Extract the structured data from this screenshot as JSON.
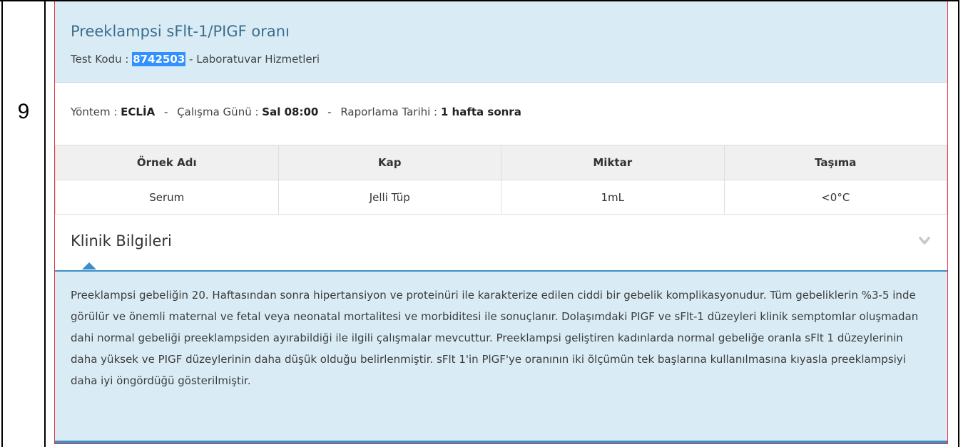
{
  "row": {
    "number": "9"
  },
  "test": {
    "title": "Preeklampsi sFlt-1/PIGF oranı",
    "code_label": "Test Kodu : ",
    "code_value": "8742503",
    "department": " - Laboratuvar Hizmetleri"
  },
  "method": {
    "method_label": "Yöntem : ",
    "method_value": "ECLİA",
    "day_label": "Çalışma Günü : ",
    "day_value": "Sal 08:00",
    "report_label": "Raporlama Tarihi : ",
    "report_value": "1 hafta sonra",
    "separator": "-"
  },
  "sample_table": {
    "headers": [
      "Örnek Adı",
      "Kap",
      "Miktar",
      "Taşıma"
    ],
    "rows": [
      [
        "Serum",
        "Jelli Tüp",
        "1mL",
        "<0°C"
      ]
    ]
  },
  "clinic": {
    "title": "Klinik Bilgileri",
    "text": "Preeklampsi gebeliğin 20. Haftasından sonra hipertansiyon ve proteinüri ile karakterize edilen ciddi bir gebelik komplikasyonudur. Tüm gebeliklerin %3-5  inde görülür ve önemli maternal ve fetal veya neonatal mortalitesi ve morbiditesi ile sonuçlanır. Dolaşımdaki PIGF ve sFlt-1 düzeyleri klinik semptomlar oluşmadan dahi normal gebeliği preeklampsiden ayırabildiği ile ilgili çalışmalar mevcuttur. Preeklampsi geliştiren kadınlarda normal gebeliğe oranla sFlt 1 düzeylerinin daha yüksek ve PIGF düzeylerinin daha düşük olduğu belirlenmiştir. sFlt 1'in PlGF'ye oranının iki ölçümün tek başlarına kullanılmasına kıyasla preeklampsiyi daha iyi öngördüğü gösterilmiştir.",
    "toggle_icon": "chevron-down-icon"
  },
  "colors": {
    "header_bg": "#d9ecf5",
    "title_color": "#3b6d8c",
    "accent": "#3a8fc8",
    "card_border": "#e23b3b",
    "code_highlight": "#3390ff"
  }
}
